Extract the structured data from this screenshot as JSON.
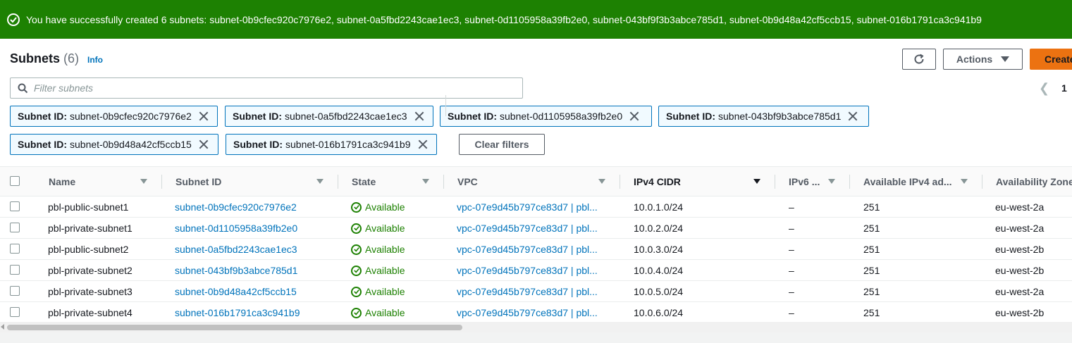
{
  "banner": {
    "message": "You have successfully created 6 subnets: subnet-0b9cfec920c7976e2, subnet-0a5fbd2243cae1ec3, subnet-0d1105958a39fb2e0, subnet-043bf9f3b3abce785d1, subnet-0b9d48a42cf5ccb15, subnet-016b1791ca3c941b9",
    "color": "#1d8102"
  },
  "header": {
    "title": "Subnets",
    "count": "(6)",
    "info": "Info",
    "actions_label": "Actions",
    "create_label": "Create",
    "search_placeholder": "Filter subnets",
    "page_number": "1",
    "clear_filters_label": "Clear filters"
  },
  "filters": [
    {
      "key": "Subnet ID:",
      "value": "subnet-0b9cfec920c7976e2"
    },
    {
      "key": "Subnet ID:",
      "value": "subnet-0a5fbd2243cae1ec3"
    },
    {
      "key": "Subnet ID:",
      "value": "subnet-0d1105958a39fb2e0"
    },
    {
      "key": "Subnet ID:",
      "value": "subnet-043bf9b3abce785d1"
    },
    {
      "key": "Subnet ID:",
      "value": "subnet-0b9d48a42cf5ccb15"
    },
    {
      "key": "Subnet ID:",
      "value": "subnet-016b1791ca3c941b9"
    }
  ],
  "columns": [
    "Name",
    "Subnet ID",
    "State",
    "VPC",
    "IPv4 CIDR",
    "IPv6 ...",
    "Available IPv4 ad...",
    "Availability Zone"
  ],
  "rows": [
    {
      "name": "pbl-public-subnet1",
      "subnet_id": "subnet-0b9cfec920c7976e2",
      "state": "Available",
      "vpc": "vpc-07e9d45b797ce83d7 | pbl...",
      "cidr": "10.0.1.0/24",
      "ipv6": "–",
      "available": "251",
      "az": "eu-west-2a"
    },
    {
      "name": "pbl-private-subnet1",
      "subnet_id": "subnet-0d1105958a39fb2e0",
      "state": "Available",
      "vpc": "vpc-07e9d45b797ce83d7 | pbl...",
      "cidr": "10.0.2.0/24",
      "ipv6": "–",
      "available": "251",
      "az": "eu-west-2a"
    },
    {
      "name": "pbl-public-subnet2",
      "subnet_id": "subnet-0a5fbd2243cae1ec3",
      "state": "Available",
      "vpc": "vpc-07e9d45b797ce83d7 | pbl...",
      "cidr": "10.0.3.0/24",
      "ipv6": "–",
      "available": "251",
      "az": "eu-west-2b"
    },
    {
      "name": "pbl-private-subnet2",
      "subnet_id": "subnet-043bf9b3abce785d1",
      "state": "Available",
      "vpc": "vpc-07e9d45b797ce83d7 | pbl...",
      "cidr": "10.0.4.0/24",
      "ipv6": "–",
      "available": "251",
      "az": "eu-west-2b"
    },
    {
      "name": "pbl-private-subnet3",
      "subnet_id": "subnet-0b9d48a42cf5ccb15",
      "state": "Available",
      "vpc": "vpc-07e9d45b797ce83d7 | pbl...",
      "cidr": "10.0.5.0/24",
      "ipv6": "–",
      "available": "251",
      "az": "eu-west-2a"
    },
    {
      "name": "pbl-private-subnet4",
      "subnet_id": "subnet-016b1791ca3c941b9",
      "state": "Available",
      "vpc": "vpc-07e9d45b797ce83d7 | pbl...",
      "cidr": "10.0.6.0/24",
      "ipv6": "–",
      "available": "251",
      "az": "eu-west-2b"
    }
  ]
}
